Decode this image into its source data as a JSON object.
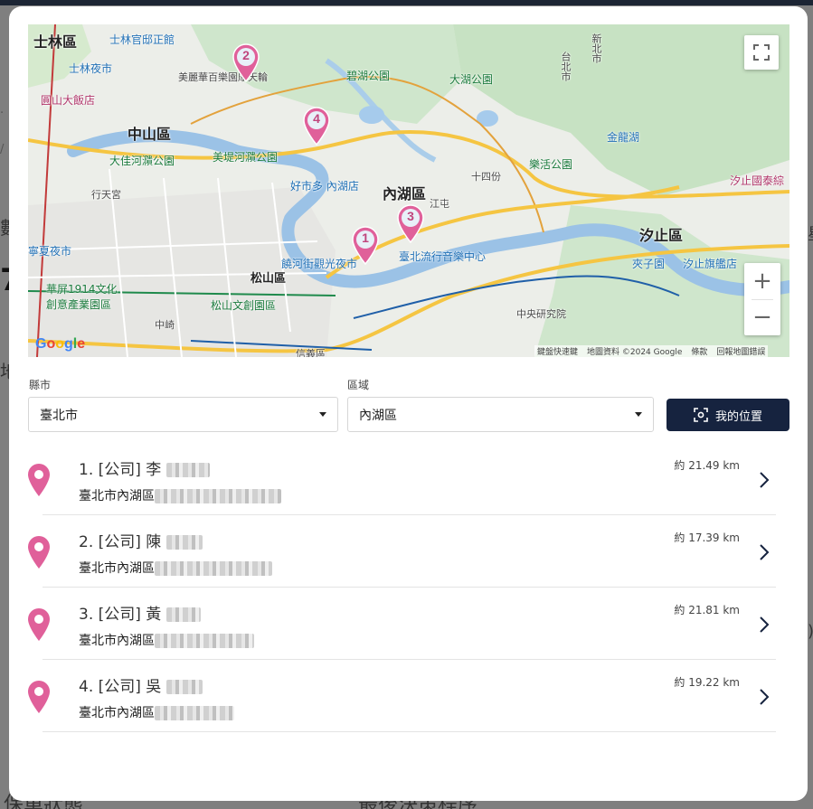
{
  "background": {
    "fragments": [
      "保單狀態",
      "最後決策程序"
    ]
  },
  "map": {
    "labels": {
      "shilin": "士林區",
      "shilin_residence": "士林官邸正館",
      "shilin_market": "士林夜市",
      "grand_hotel": "圓山大飯店",
      "zhongshan": "中山區",
      "miramar": "美麗華百樂園摩天輪",
      "dajia_park": "大佳河濻公園",
      "meiti_park": "美堤河濻公園",
      "bihu_park": "碧湖公園",
      "dahu_park": "大湖公園",
      "neihu": "內湖區",
      "costco": "好市多 內湖店",
      "raohe": "饒河街觀光夜市",
      "songshan": "松山區",
      "music_center": "臺北流行音樂中心",
      "huashan": "華屏1914文化創意產業園區",
      "songshan_cultural": "松山文創園區",
      "xinyi": "信義區",
      "zhongshan_ns": "中央研究院",
      "lehuo_park": "樂活公園",
      "jinlong_lake": "金龍湖",
      "xizhi": "汐止區",
      "xizhi_hospital": "汐止國泰綜",
      "jiaziyuan": "夾子園",
      "xizhi_flagship": "汐止旗艦店",
      "xingtian": "行天宮",
      "ningxia": "寧夏夜市",
      "new_taipei": "新北市",
      "taipei": "台北市",
      "shiyi": "十四份",
      "jiangcuo": "江屯",
      "zhongzhi": "中崎"
    },
    "attribution": [
      "鍵盤快速鍵",
      "地圖資料 ©2024 Google",
      "條款",
      "回報地圖錯誤"
    ],
    "google_logo": "Google",
    "markers": [
      "1",
      "2",
      "3",
      "4"
    ],
    "zoom_in": "+",
    "zoom_out": "−"
  },
  "filters": {
    "city_label": "縣市",
    "city_value": "臺北市",
    "district_label": "區域",
    "district_value": "內湖區",
    "locate_button": "我的位置"
  },
  "results": [
    {
      "title": "1. [公司] 李",
      "address": "臺北市內湖區",
      "distance": "約 21.49 km"
    },
    {
      "title": "2. [公司] 陳",
      "address": "臺北市內湖區",
      "distance": "約 17.39 km"
    },
    {
      "title": "3. [公司] 黃",
      "address": "臺北市內湖區",
      "distance": "約 21.81 km"
    },
    {
      "title": "4. [公司] 吳",
      "address": "臺北市內湖區",
      "distance": "約 19.22 km"
    }
  ],
  "colors": {
    "marker": "#e0609a",
    "primary_button": "#16233f",
    "overlay": "#7f7f7f"
  }
}
